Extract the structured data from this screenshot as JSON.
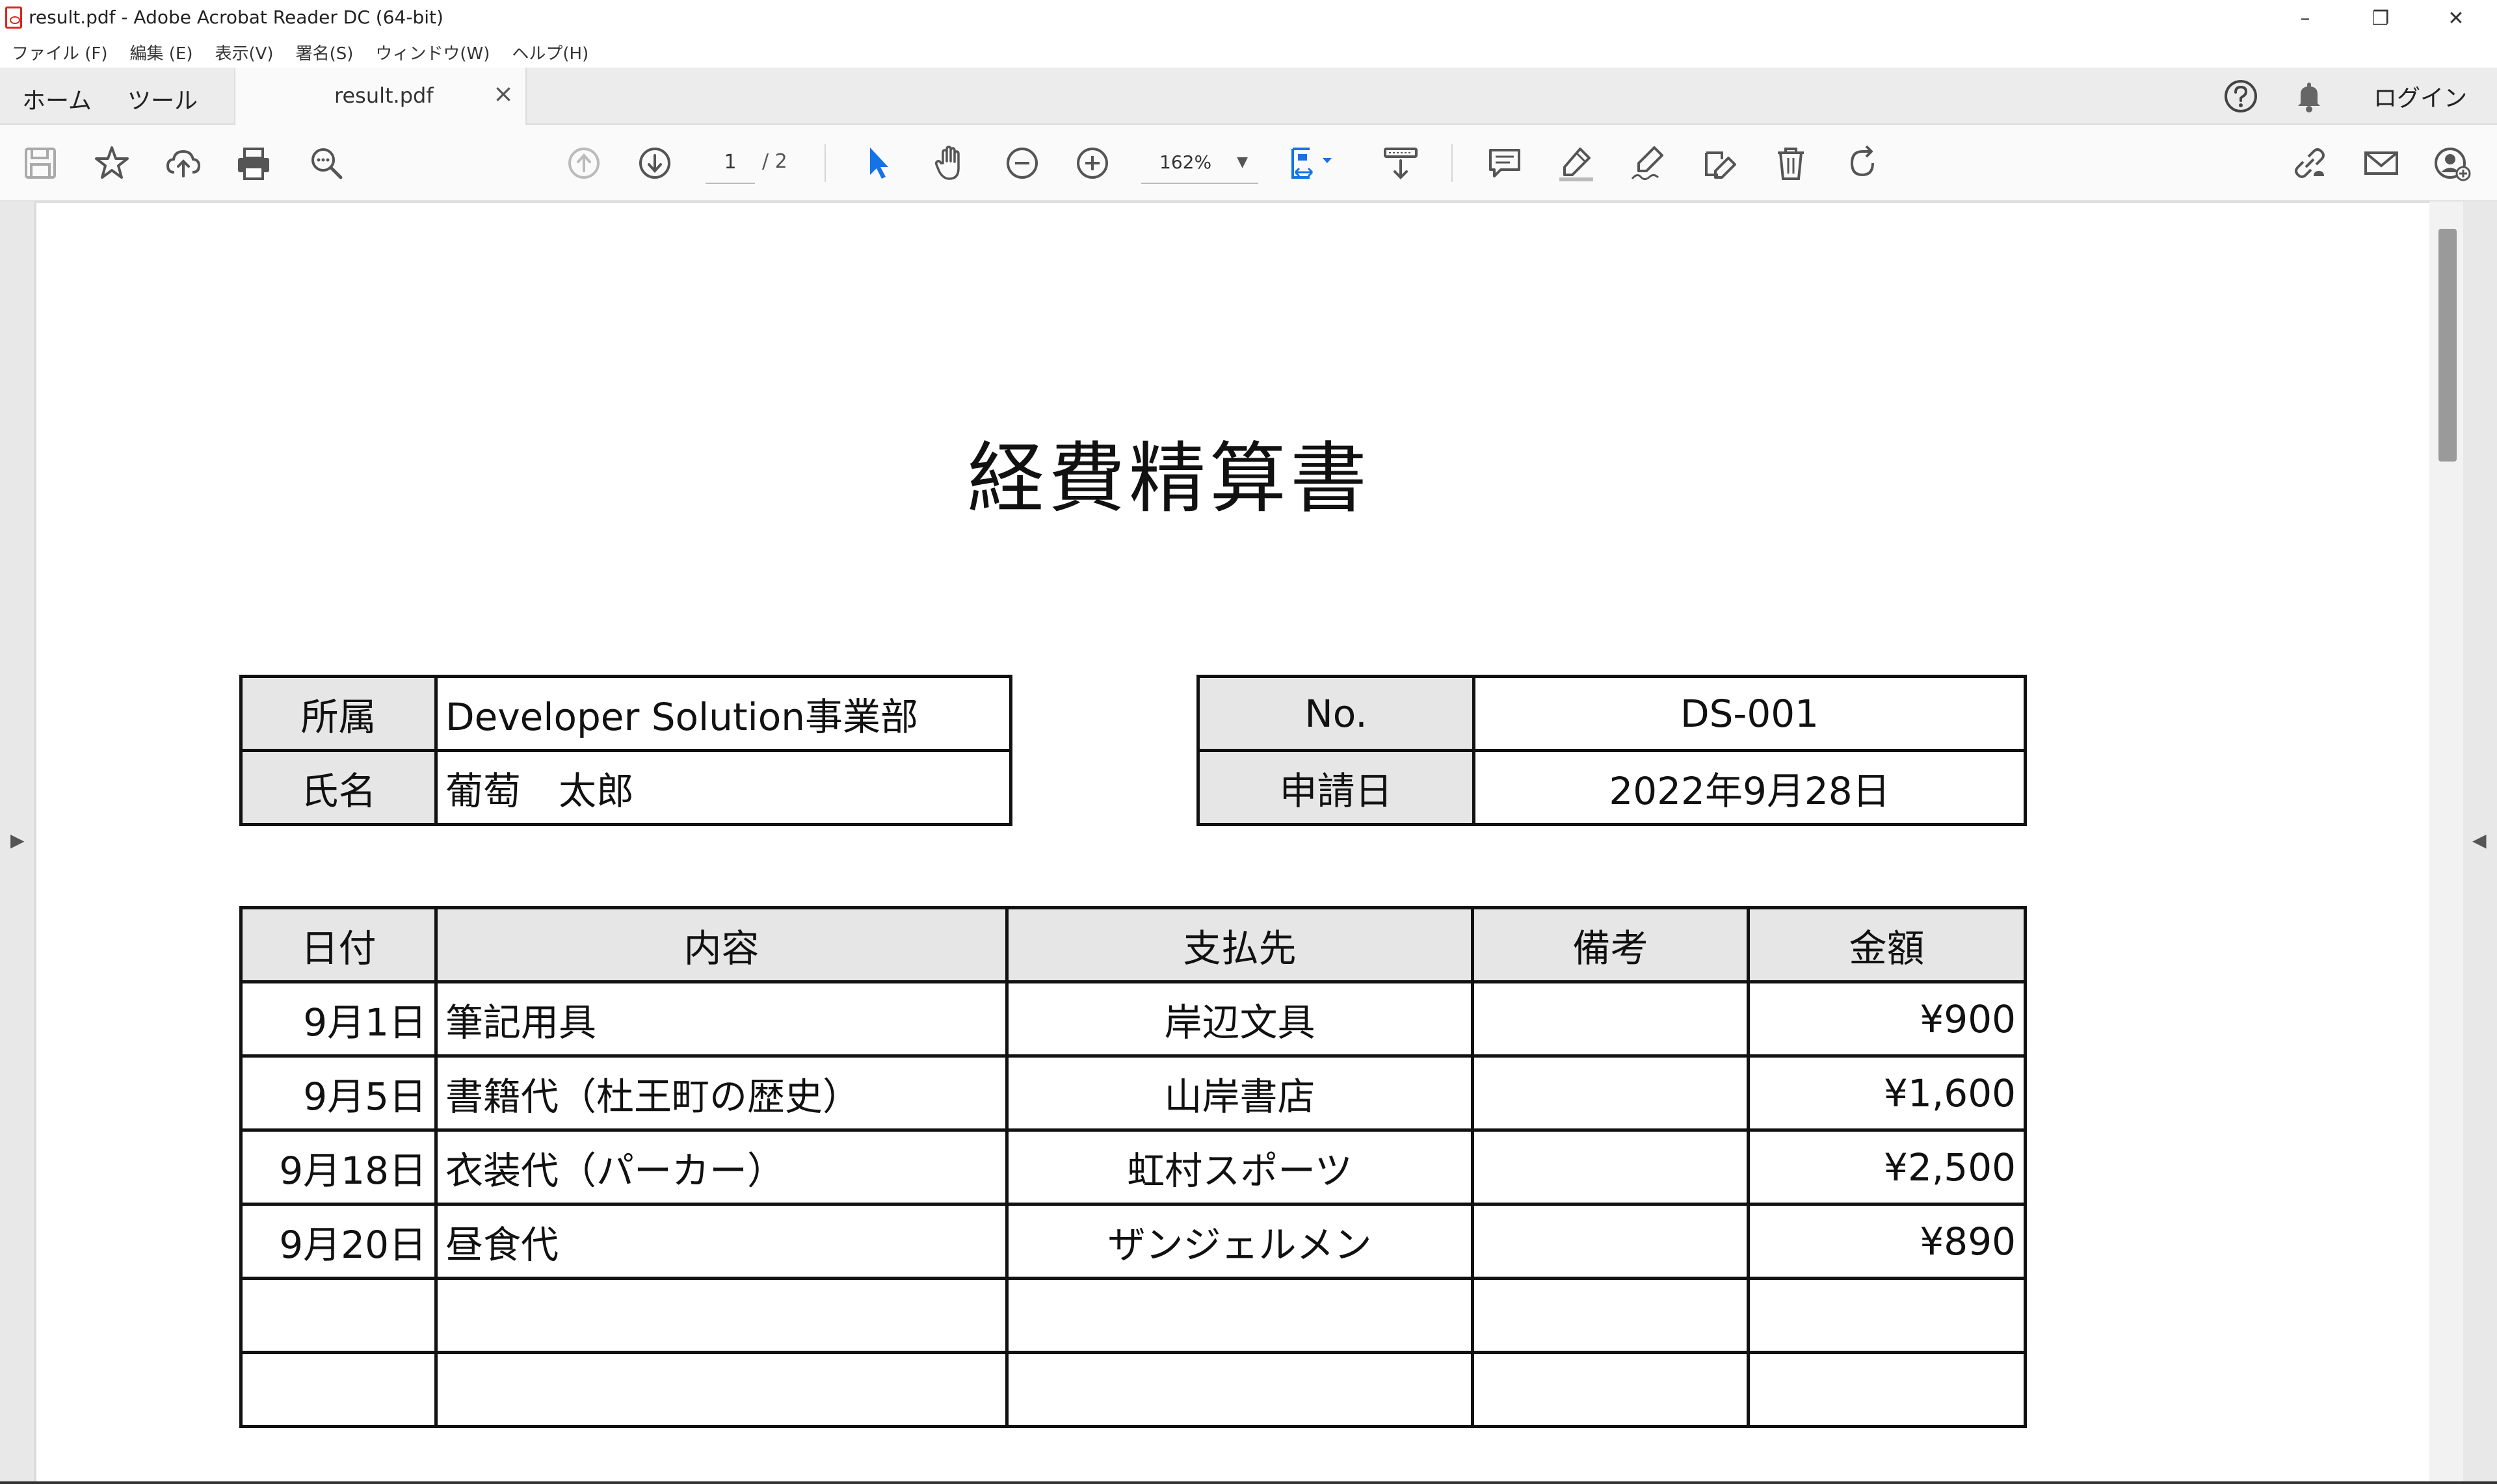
{
  "window": {
    "title": "result.pdf - Adobe Acrobat Reader DC (64-bit)",
    "controls": [
      "–",
      "❐",
      "✕"
    ]
  },
  "menu": [
    "ファイル (F)",
    "編集 (E)",
    "表示(V)",
    "署名(S)",
    "ウィンドウ(W)",
    "ヘルプ(H)"
  ],
  "tabs": {
    "home": "ホーム",
    "tools": "ツール",
    "document": "result.pdf",
    "close": "×",
    "login": "ログイン"
  },
  "toolbar": {
    "page_current": "1",
    "page_total": "/ 2",
    "zoom": "162%",
    "accent_color": "#1473e6"
  },
  "document": {
    "title": "経費精算書",
    "info_left": [
      {
        "label": "所属",
        "value": "Developer Solution事業部"
      },
      {
        "label": "氏名",
        "value": "葡萄　太郎"
      }
    ],
    "info_right": [
      {
        "label": "No.",
        "value": "DS-001"
      },
      {
        "label": "申請日",
        "value": "2022年9月28日"
      }
    ],
    "columns": [
      "日付",
      "内容",
      "支払先",
      "備考",
      "金額"
    ],
    "rows": [
      {
        "date": "9月1日",
        "item": "筆記用具",
        "payee": "岸辺文具",
        "note": "",
        "amount": "¥900"
      },
      {
        "date": "9月5日",
        "item": "書籍代（杜王町の歴史）",
        "payee": "山岸書店",
        "note": "",
        "amount": "¥1,600"
      },
      {
        "date": "9月18日",
        "item": "衣装代（パーカー）",
        "payee": "虹村スポーツ",
        "note": "",
        "amount": "¥2,500"
      },
      {
        "date": "9月20日",
        "item": "昼食代",
        "payee": "ザンジェルメン",
        "note": "",
        "amount": "¥890"
      },
      {
        "date": "",
        "item": "",
        "payee": "",
        "note": "",
        "amount": ""
      },
      {
        "date": "",
        "item": "",
        "payee": "",
        "note": "",
        "amount": ""
      }
    ]
  }
}
